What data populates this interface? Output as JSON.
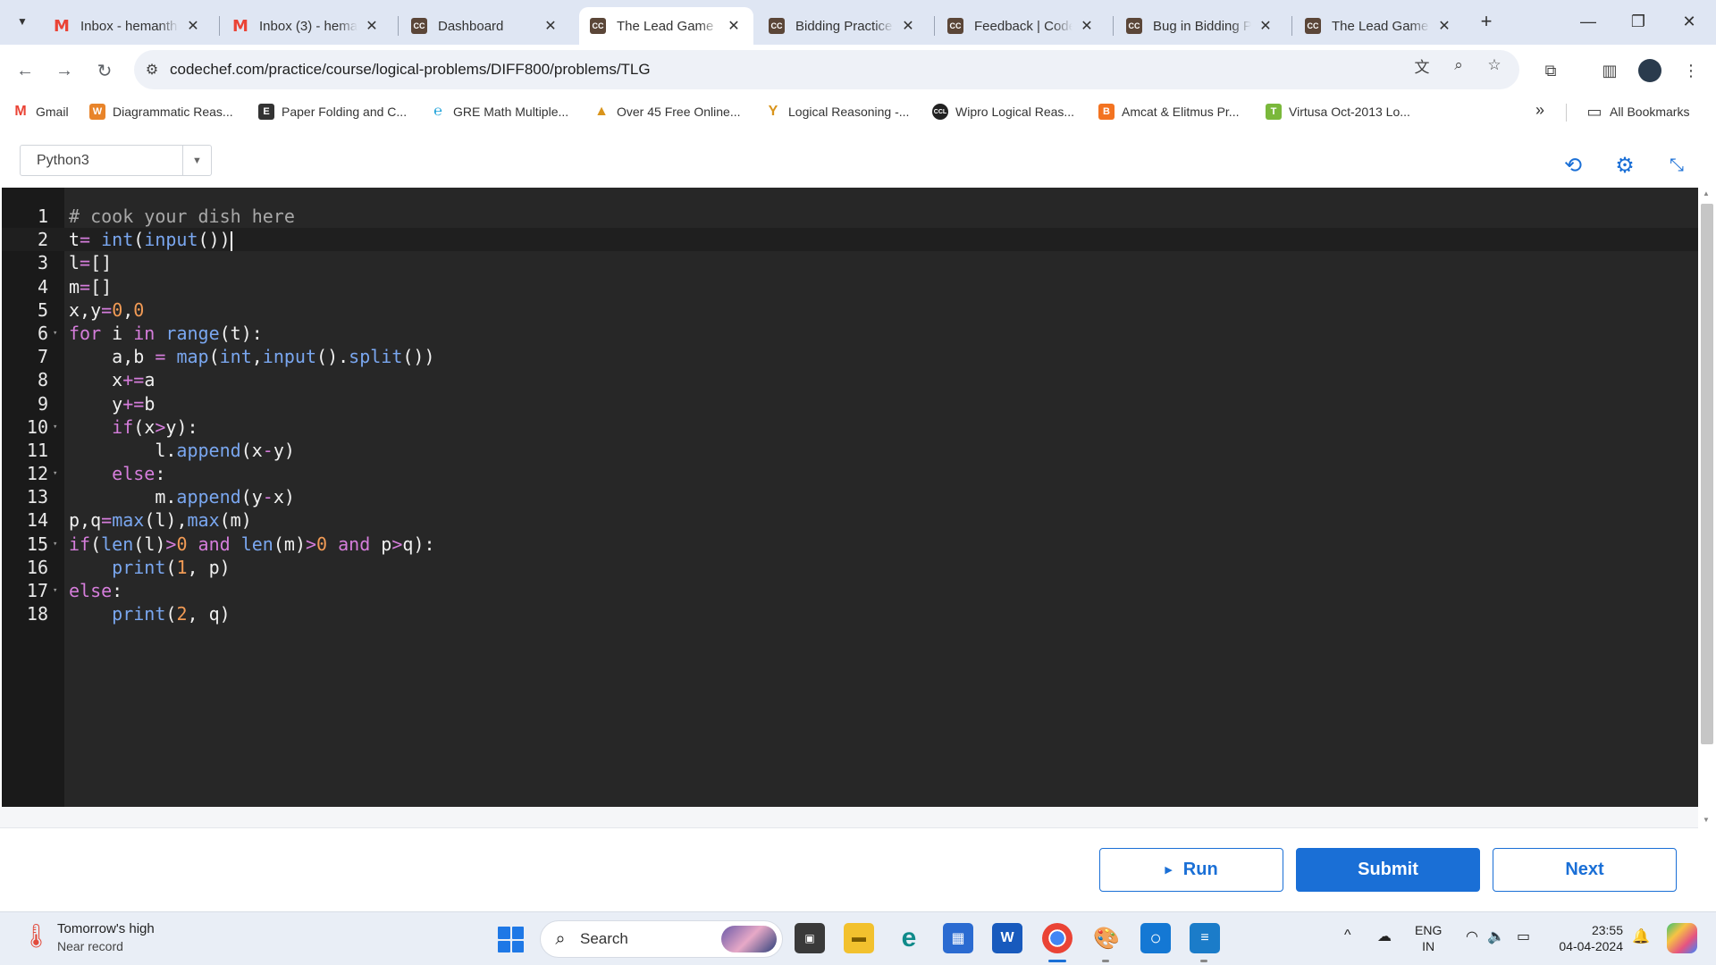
{
  "tabs": [
    {
      "title": "Inbox - hemanth",
      "favicon": "gmail-icon"
    },
    {
      "title": "Inbox (3) - hema",
      "favicon": "gmail-icon"
    },
    {
      "title": "Dashboard",
      "favicon": "codechef-icon"
    },
    {
      "title": "The Lead Game",
      "favicon": "codechef-icon",
      "active": true
    },
    {
      "title": "Bidding Practice",
      "favicon": "codechef-icon"
    },
    {
      "title": "Feedback | Code",
      "favicon": "codechef-icon"
    },
    {
      "title": "Bug in Bidding P",
      "favicon": "codechef-icon"
    },
    {
      "title": "The Lead Game",
      "favicon": "codechef-icon"
    }
  ],
  "address": {
    "url": "codechef.com/practice/course/logical-problems/DIFF800/problems/TLG"
  },
  "bookmarks": [
    {
      "label": "Gmail",
      "icon": "gmail-icon"
    },
    {
      "label": "Diagrammatic Reas...",
      "icon": "w-icon"
    },
    {
      "label": "Paper Folding and C...",
      "icon": "doc-icon"
    },
    {
      "label": "GRE Math Multiple...",
      "icon": "e-icon"
    },
    {
      "label": "Over 45 Free Online...",
      "icon": "grad-icon"
    },
    {
      "label": "Logical Reasoning -...",
      "icon": "y-icon"
    },
    {
      "label": "Wipro Logical Reas...",
      "icon": "ccl-icon"
    },
    {
      "label": "Amcat & Elitmus Pr...",
      "icon": "blogger-icon"
    },
    {
      "label": "Virtusa Oct-2013 Lo...",
      "icon": "t-icon"
    }
  ],
  "all_bookmarks": "All Bookmarks",
  "editor": {
    "language": "Python3",
    "lines": [
      {
        "n": "1",
        "code": "# cook your dish here"
      },
      {
        "n": "2",
        "code": "t= int(input())"
      },
      {
        "n": "3",
        "code": "l=[]"
      },
      {
        "n": "4",
        "code": "m=[]"
      },
      {
        "n": "5",
        "code": "x,y=0,0"
      },
      {
        "n": "6",
        "code": "for i in range(t):",
        "fold": true
      },
      {
        "n": "7",
        "code": "    a,b = map(int,input().split())"
      },
      {
        "n": "8",
        "code": "    x+=a"
      },
      {
        "n": "9",
        "code": "    y+=b"
      },
      {
        "n": "10",
        "code": "    if(x>y):",
        "fold": true
      },
      {
        "n": "11",
        "code": "        l.append(x-y)"
      },
      {
        "n": "12",
        "code": "    else:",
        "fold": true
      },
      {
        "n": "13",
        "code": "        m.append(y-x)"
      },
      {
        "n": "14",
        "code": "p,q=max(l),max(m)"
      },
      {
        "n": "15",
        "code": "if(len(l)>0 and len(m)>0 and p>q):",
        "fold": true
      },
      {
        "n": "16",
        "code": "    print(1, p)"
      },
      {
        "n": "17",
        "code": "else:",
        "fold": true
      },
      {
        "n": "18",
        "code": "    print(2, q)"
      }
    ]
  },
  "actions": {
    "run": "Run",
    "submit": "Submit",
    "next": "Next"
  },
  "taskbar": {
    "weather_title": "Tomorrow's high",
    "weather_sub": "Near record",
    "search_placeholder": "Search",
    "lang_top": "ENG",
    "lang_bottom": "IN",
    "time": "23:55",
    "date": "04-04-2024"
  },
  "colors": {
    "accent": "#1a6fd6",
    "editor_bg": "#272727",
    "tabstrip": "#dfe6f3"
  }
}
